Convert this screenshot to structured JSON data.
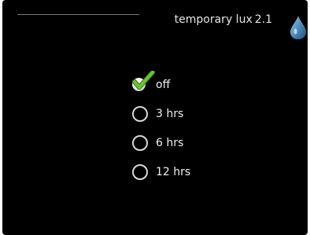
{
  "header": {
    "title": "temporary lux",
    "menu_code": "2.1",
    "icon": "water-drop-icon"
  },
  "options": [
    {
      "label": "off",
      "selected": true,
      "icon": "checkmark-icon"
    },
    {
      "label": "3 hrs",
      "selected": false,
      "icon": "radio-empty-icon"
    },
    {
      "label": "6 hrs",
      "selected": false,
      "icon": "radio-empty-icon"
    },
    {
      "label": "12 hrs",
      "selected": false,
      "icon": "radio-empty-icon"
    }
  ],
  "colors": {
    "background": "#000000",
    "text": "#f2f2f2",
    "check": "#5fb52c",
    "drop": "#4a88b8"
  }
}
